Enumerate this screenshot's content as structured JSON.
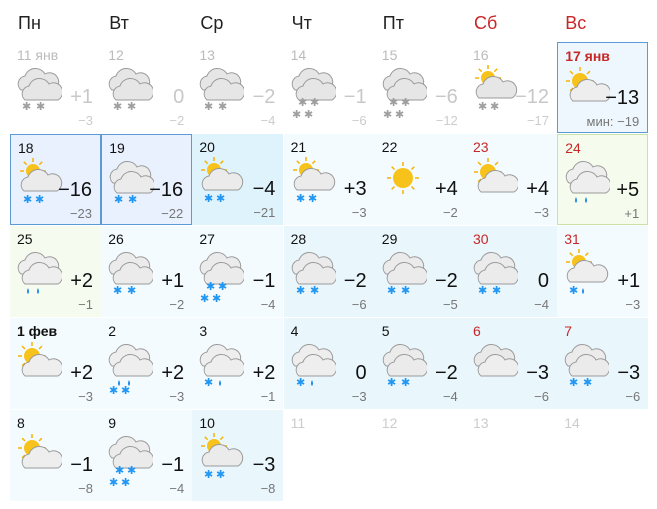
{
  "weekdays": [
    {
      "label": "Пн",
      "weekend": false
    },
    {
      "label": "Вт",
      "weekend": false
    },
    {
      "label": "Ср",
      "weekend": false
    },
    {
      "label": "Чт",
      "weekend": false
    },
    {
      "label": "Пт",
      "weekend": false
    },
    {
      "label": "Сб",
      "weekend": true
    },
    {
      "label": "Вс",
      "weekend": true
    }
  ],
  "rows": [
    [
      {
        "date": "11 янв",
        "max": "+1",
        "min": "−3",
        "past": true,
        "icon": "cloudy-snow-icon"
      },
      {
        "date": "12",
        "max": "0",
        "min": "−2",
        "past": true,
        "icon": "cloudy-snow-icon"
      },
      {
        "date": "13",
        "max": "−2",
        "min": "−4",
        "past": true,
        "icon": "cloudy-snow-icon"
      },
      {
        "date": "14",
        "max": "−1",
        "min": "−6",
        "past": true,
        "icon": "cloudy-heavy-snow-icon"
      },
      {
        "date": "15",
        "max": "−6",
        "min": "−12",
        "past": true,
        "icon": "cloudy-heavy-snow-icon"
      },
      {
        "date": "16",
        "max": "−12",
        "min": "−17",
        "past": true,
        "icon": "sun-cloud-snow-icon"
      },
      {
        "date": "17 янв",
        "max": "−13",
        "min": "мин: −19",
        "today": true,
        "icon": "sun-cloud-icon"
      }
    ],
    [
      {
        "date": "18",
        "max": "−16",
        "min": "−23",
        "style": "b",
        "icon": "sun-cloud-snow-icon"
      },
      {
        "date": "19",
        "max": "−16",
        "min": "−22",
        "style": "b",
        "icon": "cloudy-snow-icon"
      },
      {
        "date": "20",
        "max": "−4",
        "min": "−21",
        "style": "c",
        "icon": "sun-cloud-snow-icon"
      },
      {
        "date": "21",
        "max": "+3",
        "min": "−3",
        "style": "a",
        "icon": "sun-cloud-snow-icon"
      },
      {
        "date": "22",
        "max": "+4",
        "min": "−2",
        "style": "a",
        "icon": "sun-icon"
      },
      {
        "date": "23",
        "max": "+4",
        "min": "−3",
        "style": "a",
        "icon": "sun-cloud-icon",
        "red": true
      },
      {
        "date": "24",
        "max": "+5",
        "min": "+1",
        "style": "d",
        "icon": "cloudy-rain-icon",
        "red": true
      }
    ],
    [
      {
        "date": "25",
        "max": "+2",
        "min": "−1",
        "style": "e",
        "icon": "cloudy-rain-icon"
      },
      {
        "date": "26",
        "max": "+1",
        "min": "−2",
        "style": "a",
        "icon": "cloudy-snow-icon"
      },
      {
        "date": "27",
        "max": "−1",
        "min": "−4",
        "style": "a",
        "icon": "cloudy-heavy-snow-icon"
      },
      {
        "date": "28",
        "max": "−2",
        "min": "−6",
        "style": "f",
        "icon": "cloudy-snow-icon"
      },
      {
        "date": "29",
        "max": "−2",
        "min": "−5",
        "style": "f",
        "icon": "cloudy-snow-icon"
      },
      {
        "date": "30",
        "max": "0",
        "min": "−4",
        "style": "f",
        "icon": "cloudy-snow-icon",
        "red": true
      },
      {
        "date": "31",
        "max": "+1",
        "min": "−3",
        "style": "a",
        "icon": "sun-cloud-sleet-icon",
        "red": true
      }
    ],
    [
      {
        "date": "1 фев",
        "max": "+2",
        "min": "−3",
        "style": "a",
        "icon": "sun-cloud-icon",
        "bold": true
      },
      {
        "date": "2",
        "max": "+2",
        "min": "−3",
        "style": "a",
        "icon": "cloudy-heavy-sleet-icon"
      },
      {
        "date": "3",
        "max": "+2",
        "min": "−1",
        "style": "a",
        "icon": "cloudy-sleet-icon"
      },
      {
        "date": "4",
        "max": "0",
        "min": "−3",
        "style": "f",
        "icon": "cloudy-sleet-icon"
      },
      {
        "date": "5",
        "max": "−2",
        "min": "−4",
        "style": "f",
        "icon": "cloudy-snow-icon"
      },
      {
        "date": "6",
        "max": "−3",
        "min": "−6",
        "style": "f",
        "icon": "cloudy-icon",
        "red": true
      },
      {
        "date": "7",
        "max": "−3",
        "min": "−6",
        "style": "f",
        "icon": "cloudy-snow-icon",
        "red": true
      }
    ],
    [
      {
        "date": "8",
        "max": "−1",
        "min": "−8",
        "style": "a",
        "icon": "sun-cloud-icon"
      },
      {
        "date": "9",
        "max": "−1",
        "min": "−4",
        "style": "a",
        "icon": "cloudy-heavy-snow-icon"
      },
      {
        "date": "10",
        "max": "−3",
        "min": "−8",
        "style": "f",
        "icon": "sun-cloud-snow-icon"
      },
      {
        "date": "11",
        "empty": true
      },
      {
        "date": "12",
        "empty": true
      },
      {
        "date": "13",
        "empty": true
      },
      {
        "date": "14",
        "empty": true
      }
    ]
  ]
}
